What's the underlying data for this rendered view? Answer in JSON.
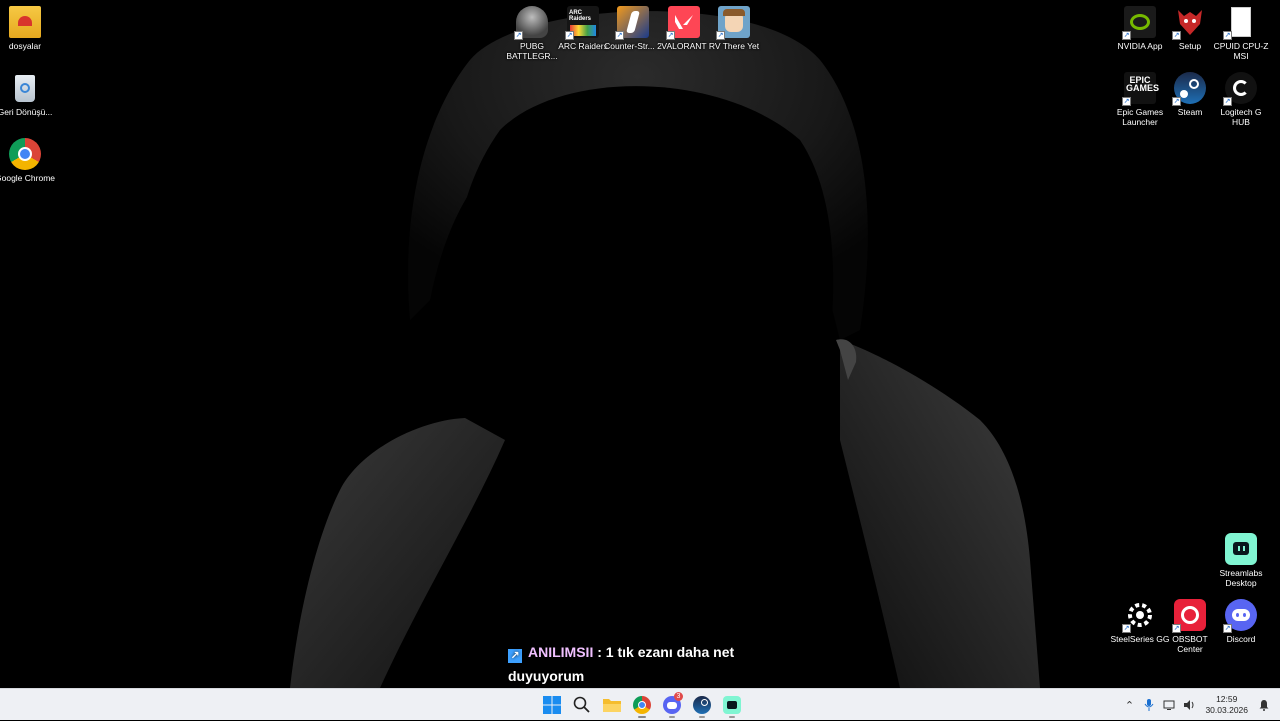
{
  "desktop": {
    "left_icons": [
      {
        "label": "dosyalar",
        "icon": "folder-icon"
      },
      {
        "label": "Geri Dönüşü...",
        "icon": "recycle-bin-icon"
      },
      {
        "label": "Google Chrome",
        "icon": "chrome-icon"
      }
    ],
    "top_icons": [
      {
        "label": "PUBG BATTLEGR...",
        "icon": "pubg-icon"
      },
      {
        "label": "ARC Raiders",
        "icon": "arc-raiders-icon"
      },
      {
        "label": "Counter-Str... 2",
        "icon": "counter-strike-icon"
      },
      {
        "label": "VALORANT",
        "icon": "valorant-icon"
      },
      {
        "label": "RV There Yet",
        "icon": "rv-there-yet-icon"
      }
    ],
    "right_icons": [
      {
        "label": "NVIDIA App",
        "icon": "nvidia-icon"
      },
      {
        "label": "Setup",
        "icon": "setup-icon"
      },
      {
        "label": "CPUID CPU-Z MSI",
        "icon": "file-icon"
      },
      {
        "label": "Epic Games Launcher",
        "icon": "epic-games-icon"
      },
      {
        "label": "Steam",
        "icon": "steam-icon"
      },
      {
        "label": "Logitech G HUB",
        "icon": "logitech-icon"
      },
      {
        "label": "Streamlabs Desktop",
        "icon": "streamlabs-icon"
      },
      {
        "label": "SteelSeries GG",
        "icon": "steelseries-icon"
      },
      {
        "label": "OBSBOT Center",
        "icon": "obsbot-icon"
      },
      {
        "label": "Discord",
        "icon": "discord-icon"
      }
    ],
    "icon_text": {
      "arc": "ARC Raiders",
      "epic": "EPIC GAMES"
    }
  },
  "overlay": {
    "username": "ANILIMSII",
    "message": " : 1 tık ezanı daha net duyuyorum"
  },
  "taskbar": {
    "apps": [
      "start-icon",
      "search-icon",
      "file-explorer-icon",
      "chrome-icon",
      "discord-icon",
      "steam-icon",
      "streamlabs-icon"
    ],
    "discord_badge": "3",
    "clock_time": "12:59",
    "clock_date": "30.03.2026"
  },
  "colors": {
    "taskbar_bg": "#eef0f4",
    "wallpaper_bg": "#000000"
  }
}
